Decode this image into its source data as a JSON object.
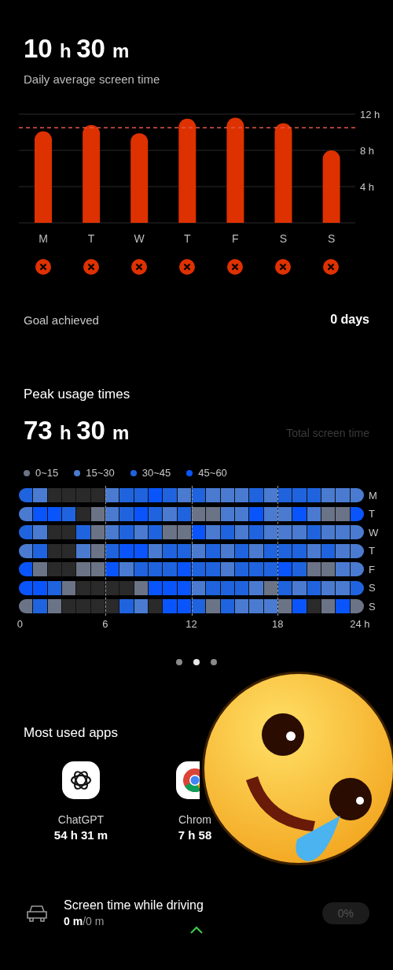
{
  "summary": {
    "average": "10 h 30 m",
    "caption": "Daily average screen time"
  },
  "weekly": {
    "chart_data": {
      "type": "bar",
      "categories": [
        "M",
        "T",
        "W",
        "T",
        "F",
        "S",
        "S"
      ],
      "values": [
        10.1,
        10.8,
        9.9,
        11.5,
        11.6,
        11,
        8
      ],
      "ylim": [
        0,
        12
      ],
      "yticks": [
        {
          "value": 4,
          "label": "4 h"
        },
        {
          "value": 8,
          "label": "8 h"
        },
        {
          "value": 12,
          "label": "12 h"
        }
      ],
      "ref_lines": [
        {
          "axis": "y",
          "value": 10.5
        }
      ]
    },
    "goal_status": [
      {
        "achieved": false
      },
      {
        "achieved": false
      },
      {
        "achieved": false
      },
      {
        "achieved": false
      },
      {
        "achieved": false
      },
      {
        "achieved": false
      },
      {
        "achieved": false
      }
    ]
  },
  "goal": {
    "label": "Goal achieved",
    "value": "0 days"
  },
  "peak": {
    "title": "Peak usage times",
    "total": "73 h 30 m",
    "total_label": "Total screen time",
    "legend": [
      {
        "label": "0~15",
        "color": "#6b7386"
      },
      {
        "label": "15~30",
        "color": "#4a7bd1"
      },
      {
        "label": "30~45",
        "color": "#1f64de"
      },
      {
        "label": "45~60",
        "color": "#0a55fb"
      }
    ],
    "rows": [
      {
        "day": "M",
        "cells": [
          {
            "color": "#1f64de"
          },
          {
            "color": "#4a7bd1"
          },
          {
            "color": "#2a2a2a"
          },
          {
            "color": "#2a2a2a"
          },
          {
            "color": "#2a2a2a"
          },
          {
            "color": "#2a2a2a"
          },
          {
            "color": "#4a7bd1"
          },
          {
            "color": "#1f64de"
          },
          {
            "color": "#1f64de"
          },
          {
            "color": "#0a55fb"
          },
          {
            "color": "#1f64de"
          },
          {
            "color": "#4a7bd1"
          },
          {
            "color": "#1f64de"
          },
          {
            "color": "#4a7bd1"
          },
          {
            "color": "#4a7bd1"
          },
          {
            "color": "#4a7bd1"
          },
          {
            "color": "#1f64de"
          },
          {
            "color": "#4a7bd1"
          },
          {
            "color": "#1f64de"
          },
          {
            "color": "#1f64de"
          },
          {
            "color": "#1f64de"
          },
          {
            "color": "#4a7bd1"
          },
          {
            "color": "#4a7bd1"
          },
          {
            "color": "#4a7bd1"
          }
        ]
      },
      {
        "day": "T",
        "cells": [
          {
            "color": "#4a7bd1"
          },
          {
            "color": "#0a55fb"
          },
          {
            "color": "#0a55fb"
          },
          {
            "color": "#1f64de"
          },
          {
            "color": "#2a2a2a"
          },
          {
            "color": "#6b7386"
          },
          {
            "color": "#4a7bd1"
          },
          {
            "color": "#1f64de"
          },
          {
            "color": "#0a55fb"
          },
          {
            "color": "#1f64de"
          },
          {
            "color": "#4a7bd1"
          },
          {
            "color": "#1f64de"
          },
          {
            "color": "#6b7386"
          },
          {
            "color": "#6b7386"
          },
          {
            "color": "#4a7bd1"
          },
          {
            "color": "#4a7bd1"
          },
          {
            "color": "#0a55fb"
          },
          {
            "color": "#4a7bd1"
          },
          {
            "color": "#4a7bd1"
          },
          {
            "color": "#0a55fb"
          },
          {
            "color": "#4a7bd1"
          },
          {
            "color": "#6b7386"
          },
          {
            "color": "#6b7386"
          },
          {
            "color": "#0a55fb"
          }
        ]
      },
      {
        "day": "W",
        "cells": [
          {
            "color": "#1f64de"
          },
          {
            "color": "#4a7bd1"
          },
          {
            "color": "#2a2a2a"
          },
          {
            "color": "#2a2a2a"
          },
          {
            "color": "#1f64de"
          },
          {
            "color": "#6b7386"
          },
          {
            "color": "#4a7bd1"
          },
          {
            "color": "#1f64de"
          },
          {
            "color": "#4a7bd1"
          },
          {
            "color": "#1f64de"
          },
          {
            "color": "#6b7386"
          },
          {
            "color": "#6b7386"
          },
          {
            "color": "#0a55fb"
          },
          {
            "color": "#4a7bd1"
          },
          {
            "color": "#1f64de"
          },
          {
            "color": "#4a7bd1"
          },
          {
            "color": "#1f64de"
          },
          {
            "color": "#4a7bd1"
          },
          {
            "color": "#4a7bd1"
          },
          {
            "color": "#4a7bd1"
          },
          {
            "color": "#1f64de"
          },
          {
            "color": "#4a7bd1"
          },
          {
            "color": "#4a7bd1"
          },
          {
            "color": "#4a7bd1"
          }
        ]
      },
      {
        "day": "T",
        "cells": [
          {
            "color": "#4a7bd1"
          },
          {
            "color": "#1f64de"
          },
          {
            "color": "#2a2a2a"
          },
          {
            "color": "#2a2a2a"
          },
          {
            "color": "#4a7bd1"
          },
          {
            "color": "#6b7386"
          },
          {
            "color": "#1f64de"
          },
          {
            "color": "#0a55fb"
          },
          {
            "color": "#0a55fb"
          },
          {
            "color": "#4a7bd1"
          },
          {
            "color": "#1f64de"
          },
          {
            "color": "#1f64de"
          },
          {
            "color": "#4a7bd1"
          },
          {
            "color": "#1f64de"
          },
          {
            "color": "#4a7bd1"
          },
          {
            "color": "#1f64de"
          },
          {
            "color": "#4a7bd1"
          },
          {
            "color": "#1f64de"
          },
          {
            "color": "#1f64de"
          },
          {
            "color": "#1f64de"
          },
          {
            "color": "#4a7bd1"
          },
          {
            "color": "#1f64de"
          },
          {
            "color": "#4a7bd1"
          },
          {
            "color": "#4a7bd1"
          }
        ]
      },
      {
        "day": "F",
        "cells": [
          {
            "color": "#0a55fb"
          },
          {
            "color": "#6b7386"
          },
          {
            "color": "#2a2a2a"
          },
          {
            "color": "#2a2a2a"
          },
          {
            "color": "#6b7386"
          },
          {
            "color": "#6b7386"
          },
          {
            "color": "#0a55fb"
          },
          {
            "color": "#4a7bd1"
          },
          {
            "color": "#1f64de"
          },
          {
            "color": "#1f64de"
          },
          {
            "color": "#1f64de"
          },
          {
            "color": "#0a55fb"
          },
          {
            "color": "#1f64de"
          },
          {
            "color": "#1f64de"
          },
          {
            "color": "#4a7bd1"
          },
          {
            "color": "#1f64de"
          },
          {
            "color": "#1f64de"
          },
          {
            "color": "#1f64de"
          },
          {
            "color": "#0a55fb"
          },
          {
            "color": "#1f64de"
          },
          {
            "color": "#6b7386"
          },
          {
            "color": "#6b7386"
          },
          {
            "color": "#4a7bd1"
          },
          {
            "color": "#4a7bd1"
          }
        ]
      },
      {
        "day": "S",
        "cells": [
          {
            "color": "#0a55fb"
          },
          {
            "color": "#0a55fb"
          },
          {
            "color": "#1f64de"
          },
          {
            "color": "#6b7386"
          },
          {
            "color": "#2a2a2a"
          },
          {
            "color": "#2a2a2a"
          },
          {
            "color": "#2a2a2a"
          },
          {
            "color": "#2a2a2a"
          },
          {
            "color": "#6b7386"
          },
          {
            "color": "#0a55fb"
          },
          {
            "color": "#0a55fb"
          },
          {
            "color": "#0a55fb"
          },
          {
            "color": "#4a7bd1"
          },
          {
            "color": "#1f64de"
          },
          {
            "color": "#1f64de"
          },
          {
            "color": "#1f64de"
          },
          {
            "color": "#4a7bd1"
          },
          {
            "color": "#6b7386"
          },
          {
            "color": "#1f64de"
          },
          {
            "color": "#4a7bd1"
          },
          {
            "color": "#1f64de"
          },
          {
            "color": "#4a7bd1"
          },
          {
            "color": "#4a7bd1"
          },
          {
            "color": "#1f64de"
          }
        ]
      },
      {
        "day": "S",
        "cells": [
          {
            "color": "#6b7386"
          },
          {
            "color": "#1f64de"
          },
          {
            "color": "#6b7386"
          },
          {
            "color": "#2a2a2a"
          },
          {
            "color": "#2a2a2a"
          },
          {
            "color": "#2a2a2a"
          },
          {
            "color": "#2a2a2a"
          },
          {
            "color": "#1f64de"
          },
          {
            "color": "#4a7bd1"
          },
          {
            "color": "#2a2a2a"
          },
          {
            "color": "#0a55fb"
          },
          {
            "color": "#0a55fb"
          },
          {
            "color": "#1f64de"
          },
          {
            "color": "#6b7386"
          },
          {
            "color": "#1f64de"
          },
          {
            "color": "#4a7bd1"
          },
          {
            "color": "#4a7bd1"
          },
          {
            "color": "#4a7bd1"
          },
          {
            "color": "#6b7386"
          },
          {
            "color": "#0a55fb"
          },
          {
            "color": "#2a2a2a"
          },
          {
            "color": "#6b7386"
          },
          {
            "color": "#0a55fb"
          },
          {
            "color": "#6b7386"
          }
        ]
      }
    ],
    "axis": [
      "0",
      "6",
      "12",
      "18",
      "24 h"
    ]
  },
  "pager": [
    {
      "selected": false
    },
    {
      "selected": true
    },
    {
      "selected": false
    }
  ],
  "apps": {
    "title": "Most used apps",
    "items": [
      {
        "kind": "knot",
        "name": "ChatGPT",
        "time": "54 h 31 m"
      },
      {
        "kind": "browser",
        "name": "Chrom",
        "time": "7 h 58"
      }
    ]
  },
  "driving": {
    "title": "Screen time while driving",
    "value": "**0 m**/0 m",
    "percent": "0%"
  }
}
